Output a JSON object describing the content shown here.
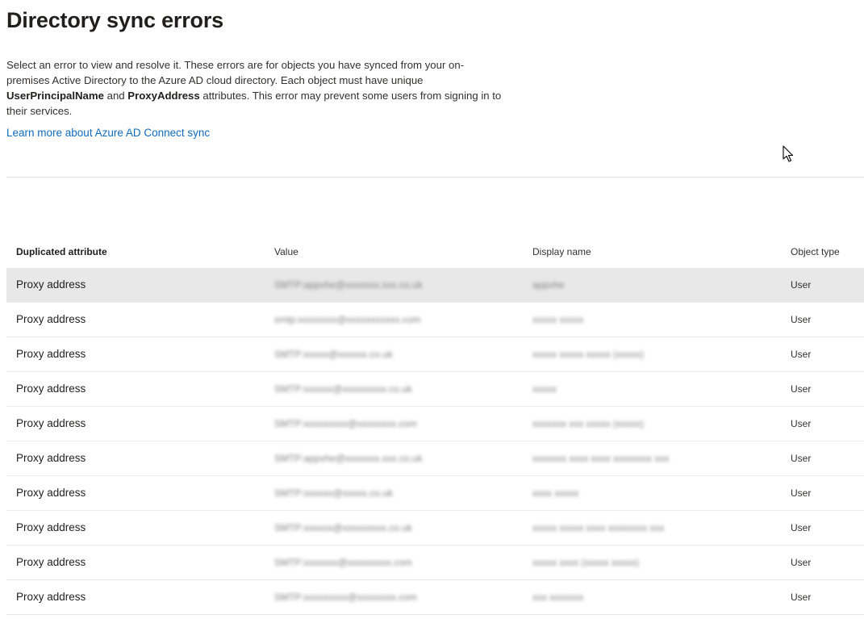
{
  "page": {
    "title": "Directory sync errors",
    "description": {
      "part1": "Select an error to view and resolve it. These errors are for objects you have synced from your on-premises Active Directory to the Azure AD cloud directory. Each object must have unique ",
      "bold1": "UserPrincipalName",
      "part2": " and ",
      "bold2": "ProxyAddress",
      "part3": " attributes. This error may prevent some users from signing in to their services."
    },
    "learn_more_link": "Learn more about Azure AD Connect sync"
  },
  "table": {
    "columns": [
      "Duplicated attribute",
      "Value",
      "Display name",
      "Object type"
    ],
    "rows": [
      {
        "attribute": "Proxy address",
        "value": "SMTP:appvhe@xxxxxxx.xxx.co.uk",
        "display_name": "appvhe",
        "object_type": "User",
        "selected": true
      },
      {
        "attribute": "Proxy address",
        "value": "smtp:xxxxxxxx@xxxxxxxxxxx.com",
        "display_name": "xxxxx xxxxx",
        "object_type": "User",
        "selected": false
      },
      {
        "attribute": "Proxy address",
        "value": "SMTP:xxxxx@xxxxxx.co.uk",
        "display_name": "xxxxx xxxxx xxxxx (xxxxx)",
        "object_type": "User",
        "selected": false
      },
      {
        "attribute": "Proxy address",
        "value": "SMTP:xxxxxx@xxxxxxxxx.co.uk",
        "display_name": "xxxxx",
        "object_type": "User",
        "selected": false
      },
      {
        "attribute": "Proxy address",
        "value": "SMTP:xxxxxxxxx@xxxxxxxx.com",
        "display_name": "xxxxxxx xxx xxxxx (xxxxx)",
        "object_type": "User",
        "selected": false
      },
      {
        "attribute": "Proxy address",
        "value": "SMTP:appvhe@xxxxxxx.xxx.co.uk",
        "display_name": "xxxxxxx xxxx xxxx xxxxxxxx xxx",
        "object_type": "User",
        "selected": false
      },
      {
        "attribute": "Proxy address",
        "value": "SMTP:xxxxxx@xxxxx.co.uk",
        "display_name": "xxxx xxxxx",
        "object_type": "User",
        "selected": false
      },
      {
        "attribute": "Proxy address",
        "value": "SMTP:xxxxxx@xxxxxxxxx.co.uk",
        "display_name": "xxxxx xxxxx xxxx xxxxxxxx xxx",
        "object_type": "User",
        "selected": false
      },
      {
        "attribute": "Proxy address",
        "value": "SMTP:xxxxxxx@xxxxxxxxx.com",
        "display_name": "xxxxx xxxx (xxxxx xxxxx)",
        "object_type": "User",
        "selected": false
      },
      {
        "attribute": "Proxy address",
        "value": "SMTP:xxxxxxxxx@xxxxxxxx.com",
        "display_name": "xxx xxxxxxx",
        "object_type": "User",
        "selected": false
      }
    ]
  },
  "icons": {
    "cursor": "mouse-pointer-icon"
  },
  "colors": {
    "link": "#0f6cbd",
    "selected_row": "#e8e8e8",
    "divider": "#e1dfdd"
  }
}
